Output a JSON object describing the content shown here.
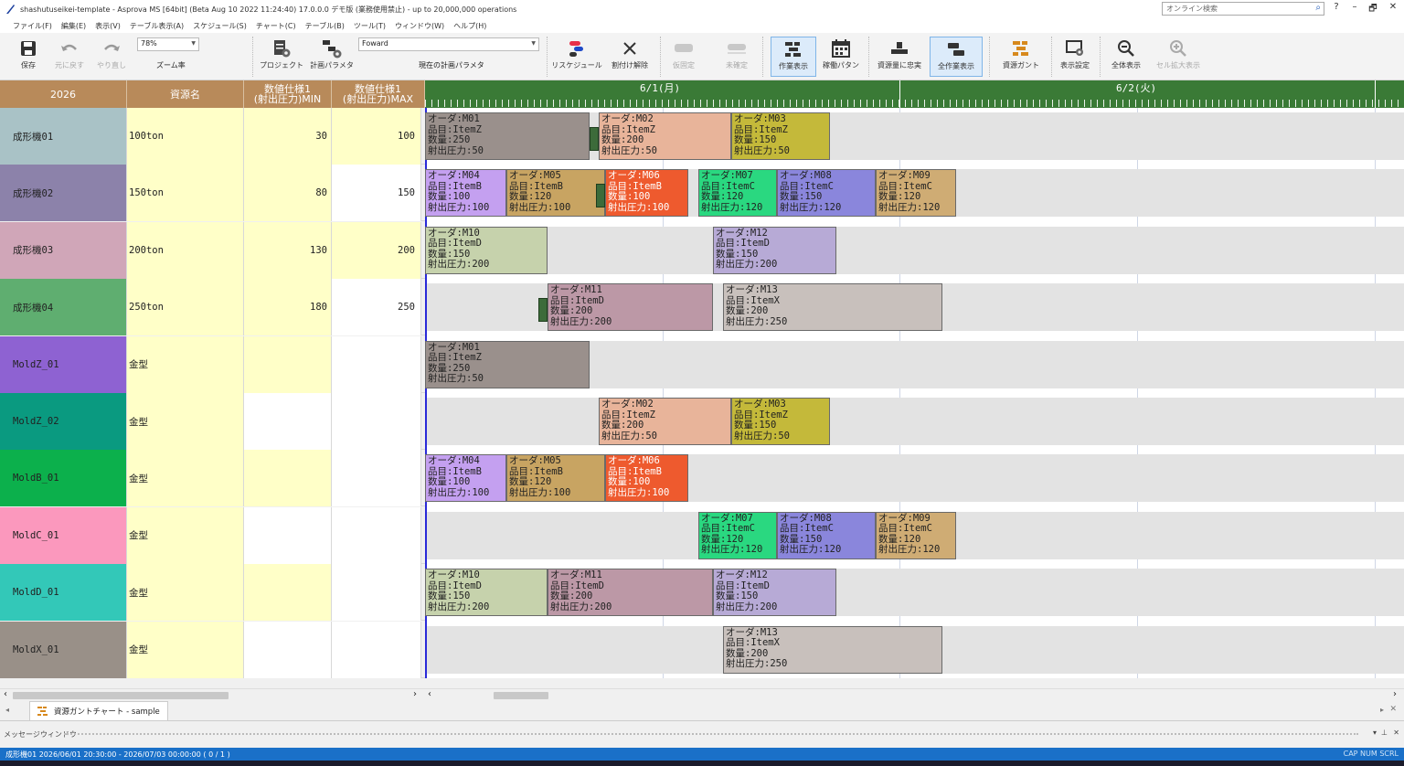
{
  "window": {
    "title": "shashutuseikei-template - Asprova MS [64bit] (Beta Aug 10 2022 11:24:40) 17.0.0.0 デモ版 (業務使用禁止) - up to 20,000,000 operations",
    "search_placeholder": "オンライン検索",
    "controls": [
      "?",
      "–",
      "🗗",
      "✕"
    ]
  },
  "menu": [
    "ファイル(F)",
    "編集(E)",
    "表示(V)",
    "テーブル表示(A)",
    "スケジュール(S)",
    "チャート(C)",
    "テーブル(B)",
    "ツール(T)",
    "ウィンドウ(W)",
    "ヘルプ(H)"
  ],
  "ribbon": {
    "save": "保存",
    "undo": "元に戻す",
    "redo": "やり直し",
    "zoom_value": "78%",
    "zoom_label": "ズーム率",
    "project": "プロジェクト",
    "plan_param": "計画パラメタ",
    "plan_combo": "Foward",
    "current_plan_param": "現在の計画パラメタ",
    "reschedule": "リスケジュール",
    "unassign": "割付け解除",
    "fixed": "仮固定",
    "unfixed": "未確定",
    "work_view": "作業表示",
    "calendar": "稼働パタン",
    "load_view": "資源量に忠実",
    "all_work_view": "全作業表示",
    "resource_gantt": "資源ガント",
    "display_settings": "表示設定",
    "show_all": "全体表示",
    "cell_zoom": "セル拡大表示"
  },
  "grid": {
    "headers": [
      "2026",
      "資源名",
      "数値仕様1\n(射出圧力)MIN",
      "数値仕様1\n(射出圧力)MAX"
    ],
    "rows": [
      {
        "code": "成形機01",
        "name": "100ton",
        "min": "30",
        "max": "100",
        "color": "#a9c2c6"
      },
      {
        "code": "成形機02",
        "name": "150ton",
        "min": "80",
        "max": "150",
        "color": "#8c82aa"
      },
      {
        "code": "成形機03",
        "name": "200ton",
        "min": "130",
        "max": "200",
        "color": "#d0a6b8"
      },
      {
        "code": "成形機04",
        "name": "250ton",
        "min": "180",
        "max": "250",
        "color": "#5fae70"
      },
      {
        "code": "MoldZ_01",
        "name": "金型",
        "min": "",
        "max": "",
        "color": "#8e62d2"
      },
      {
        "code": "MoldZ_02",
        "name": "金型",
        "min": "",
        "max": "",
        "color": "#0a9a80"
      },
      {
        "code": "MoldB_01",
        "name": "金型",
        "min": "",
        "max": "",
        "color": "#0cb04c"
      },
      {
        "code": "MoldC_01",
        "name": "金型",
        "min": "",
        "max": "",
        "color": "#fb98bd"
      },
      {
        "code": "MoldD_01",
        "name": "金型",
        "min": "",
        "max": "",
        "color": "#33c8b8"
      },
      {
        "code": "MoldX_01",
        "name": "金型",
        "min": "",
        "max": "",
        "color": "#999088"
      }
    ]
  },
  "gantt": {
    "dates": [
      "6/1(月)",
      "6/2(火)"
    ],
    "tasks": [
      {
        "row": 0,
        "order": "オーダ:M01",
        "item": "品目:ItemZ",
        "qty": "数量:250",
        "pressure": "射出圧力:50",
        "color": "#9a908c",
        "setup": true
      },
      {
        "row": 0,
        "order": "オーダ:M02",
        "item": "品目:ItemZ",
        "qty": "数量:200",
        "pressure": "射出圧力:50",
        "color": "#e8b49a",
        "setup": false
      },
      {
        "row": 0,
        "order": "オーダ:M03",
        "item": "品目:ItemZ",
        "qty": "数量:150",
        "pressure": "射出圧力:50",
        "color": "#c4b93a",
        "setup": false
      },
      {
        "row": 1,
        "order": "オーダ:M04",
        "item": "品目:ItemB",
        "qty": "数量:100",
        "pressure": "射出圧力:100",
        "color": "#c4a0f0",
        "setup": false
      },
      {
        "row": 1,
        "order": "オーダ:M05",
        "item": "品目:ItemB",
        "qty": "数量:120",
        "pressure": "射出圧力:100",
        "color": "#c8a462",
        "setup": false
      },
      {
        "row": 1,
        "order": "オーダ:M06",
        "item": "品目:ItemB",
        "qty": "数量:100",
        "pressure": "射出圧力:100",
        "color": "#ee5a2e",
        "setup": true
      },
      {
        "row": 1,
        "order": "オーダ:M07",
        "item": "品目:ItemC",
        "qty": "数量:120",
        "pressure": "射出圧力:120",
        "color": "#2ad880",
        "setup": false
      },
      {
        "row": 1,
        "order": "オーダ:M08",
        "item": "品目:ItemC",
        "qty": "数量:150",
        "pressure": "射出圧力:120",
        "color": "#8a86dc",
        "setup": false
      },
      {
        "row": 1,
        "order": "オーダ:M09",
        "item": "品目:ItemC",
        "qty": "数量:120",
        "pressure": "射出圧力:120",
        "color": "#cfac74",
        "setup": false
      },
      {
        "row": 2,
        "order": "オーダ:M10",
        "item": "品目:ItemD",
        "qty": "数量:150",
        "pressure": "射出圧力:200",
        "color": "#c6d2ac",
        "setup": false
      },
      {
        "row": 2,
        "order": "オーダ:M12",
        "item": "品目:ItemD",
        "qty": "数量:150",
        "pressure": "射出圧力:200",
        "color": "#b7aad6",
        "setup": false
      },
      {
        "row": 3,
        "order": "オーダ:M11",
        "item": "品目:ItemD",
        "qty": "数量:200",
        "pressure": "射出圧力:200",
        "color": "#bc98a6",
        "setup": true
      },
      {
        "row": 3,
        "order": "オーダ:M13",
        "item": "品目:ItemX",
        "qty": "数量:200",
        "pressure": "射出圧力:250",
        "color": "#c8c0bc",
        "setup": false
      },
      {
        "row": 4,
        "order": "オーダ:M01",
        "item": "品目:ItemZ",
        "qty": "数量:250",
        "pressure": "射出圧力:50",
        "color": "#9a908c",
        "setup": false
      },
      {
        "row": 5,
        "order": "オーダ:M02",
        "item": "品目:ItemZ",
        "qty": "数量:200",
        "pressure": "射出圧力:50",
        "color": "#e8b49a",
        "setup": false
      },
      {
        "row": 5,
        "order": "オーダ:M03",
        "item": "品目:ItemZ",
        "qty": "数量:150",
        "pressure": "射出圧力:50",
        "color": "#c4b93a",
        "setup": false
      },
      {
        "row": 6,
        "order": "オーダ:M04",
        "item": "品目:ItemB",
        "qty": "数量:100",
        "pressure": "射出圧力:100",
        "color": "#c4a0f0",
        "setup": false
      },
      {
        "row": 6,
        "order": "オーダ:M05",
        "item": "品目:ItemB",
        "qty": "数量:120",
        "pressure": "射出圧力:100",
        "color": "#c8a462",
        "setup": false
      },
      {
        "row": 6,
        "order": "オーダ:M06",
        "item": "品目:ItemB",
        "qty": "数量:100",
        "pressure": "射出圧力:100",
        "color": "#ee5a2e",
        "setup": false
      },
      {
        "row": 7,
        "order": "オーダ:M07",
        "item": "品目:ItemC",
        "qty": "数量:120",
        "pressure": "射出圧力:120",
        "color": "#2ad880",
        "setup": false
      },
      {
        "row": 7,
        "order": "オーダ:M08",
        "item": "品目:ItemC",
        "qty": "数量:150",
        "pressure": "射出圧力:120",
        "color": "#8a86dc",
        "setup": false
      },
      {
        "row": 7,
        "order": "オーダ:M09",
        "item": "品目:ItemC",
        "qty": "数量:120",
        "pressure": "射出圧力:120",
        "color": "#cfac74",
        "setup": false
      },
      {
        "row": 8,
        "order": "オーダ:M10",
        "item": "品目:ItemD",
        "qty": "数量:150",
        "pressure": "射出圧力:200",
        "color": "#c6d2ac",
        "setup": false
      },
      {
        "row": 8,
        "order": "オーダ:M11",
        "item": "品目:ItemD",
        "qty": "数量:200",
        "pressure": "射出圧力:200",
        "color": "#bc98a6",
        "setup": false
      },
      {
        "row": 8,
        "order": "オーダ:M12",
        "item": "品目:ItemD",
        "qty": "数量:150",
        "pressure": "射出圧力:200",
        "color": "#b7aad6",
        "setup": false
      },
      {
        "row": 9,
        "order": "オーダ:M13",
        "item": "品目:ItemX",
        "qty": "数量:200",
        "pressure": "射出圧力:250",
        "color": "#c8c0bc",
        "setup": false
      }
    ]
  },
  "tabs": {
    "active": "資源ガントチャート - sample"
  },
  "message_window": "メッセージウィンドウ",
  "status": {
    "left": "成形機01 2026/06/01 20:30:00 - 2026/07/03 00:00:00 ( 0 / 1 )",
    "right": "CAP  NUM  SCRL"
  }
}
